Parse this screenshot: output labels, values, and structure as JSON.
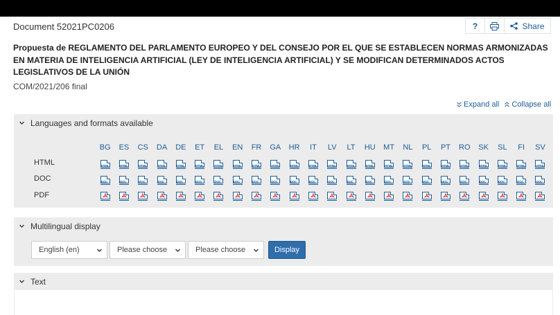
{
  "document": {
    "number": "Document 52021PC0206",
    "title": "Propuesta de REGLAMENTO DEL PARLAMENTO EUROPEO Y DEL CONSEJO POR EL QUE SE ESTABLECEN NORMAS ARMONIZADAS EN MATERIA DE INTELIGENCIA ARTIFICIAL (LEY DE INTELIGENCIA ARTIFICIAL) Y SE MODIFICAN DETERMINADOS ACTOS LEGISLATIVOS DE LA UNIÓN",
    "reference": "COM/2021/206 final"
  },
  "actions": {
    "help": "?",
    "share": "Share"
  },
  "controls": {
    "expand_all": "Expand all",
    "collapse_all": "Collapse all"
  },
  "panels": {
    "languages": {
      "heading": "Languages and formats available",
      "languages": [
        "BG",
        "ES",
        "CS",
        "DA",
        "DE",
        "ET",
        "EL",
        "EN",
        "FR",
        "GA",
        "HR",
        "IT",
        "LV",
        "LT",
        "HU",
        "MT",
        "NL",
        "PL",
        "PT",
        "RO",
        "SK",
        "SL",
        "FI",
        "SV"
      ],
      "formats": [
        {
          "label": "HTML",
          "icon": "html-file-icon",
          "tag": "HTML"
        },
        {
          "label": "DOC",
          "icon": "doc-file-icon",
          "tag": "DOC"
        },
        {
          "label": "PDF",
          "icon": "pdf-file-icon",
          "tag": ""
        }
      ]
    },
    "multilingual": {
      "heading": "Multilingual display",
      "select_1": "English (en)",
      "select_2": "Please choose",
      "select_3": "Please choose",
      "button": "Display"
    },
    "text": {
      "heading": "Text"
    }
  },
  "colors": {
    "link": "#1c5d99",
    "panel": "#ececec",
    "button": "#2f6dab",
    "pdf": "#d9302c"
  }
}
